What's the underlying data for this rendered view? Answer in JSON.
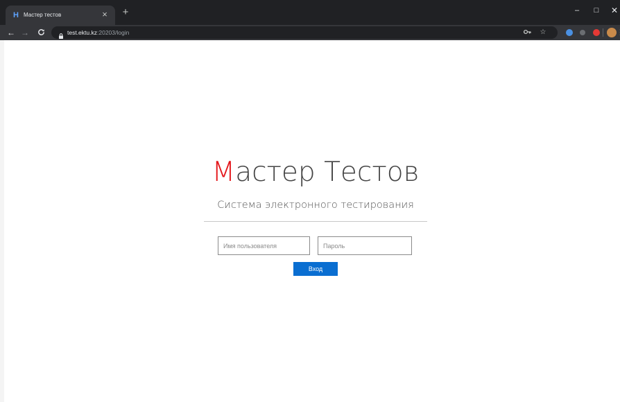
{
  "browser": {
    "tab": {
      "title": "Мастер тестов",
      "favicon": "hex-logo-icon",
      "close_glyph": "×"
    },
    "new_tab_glyph": "+",
    "window_controls": {
      "minimize": "–",
      "maximize": "□",
      "close": "✕"
    },
    "nav": {
      "back": "←",
      "forward": "→",
      "reload": "C"
    },
    "address": {
      "host": "test.ektu.kz",
      "rest": ":20203/login"
    },
    "toolbar_icons": [
      "key-icon",
      "star-icon",
      "extension-icon",
      "extension-icon",
      "extension-icon",
      "avatar",
      "menu-icon"
    ],
    "colors": {
      "tabstrip": "#202124",
      "toolbar": "#35363a",
      "omnibox": "#202124"
    }
  },
  "page": {
    "logo_first": "М",
    "logo_rest": "астер Тестов",
    "subtitle": "Система электронного тестирования",
    "username_placeholder": "Имя пользователя",
    "password_placeholder": "Пароль",
    "login_button": "Вход",
    "colors": {
      "accent": "#e4161b",
      "button": "#0a6ed1"
    }
  }
}
